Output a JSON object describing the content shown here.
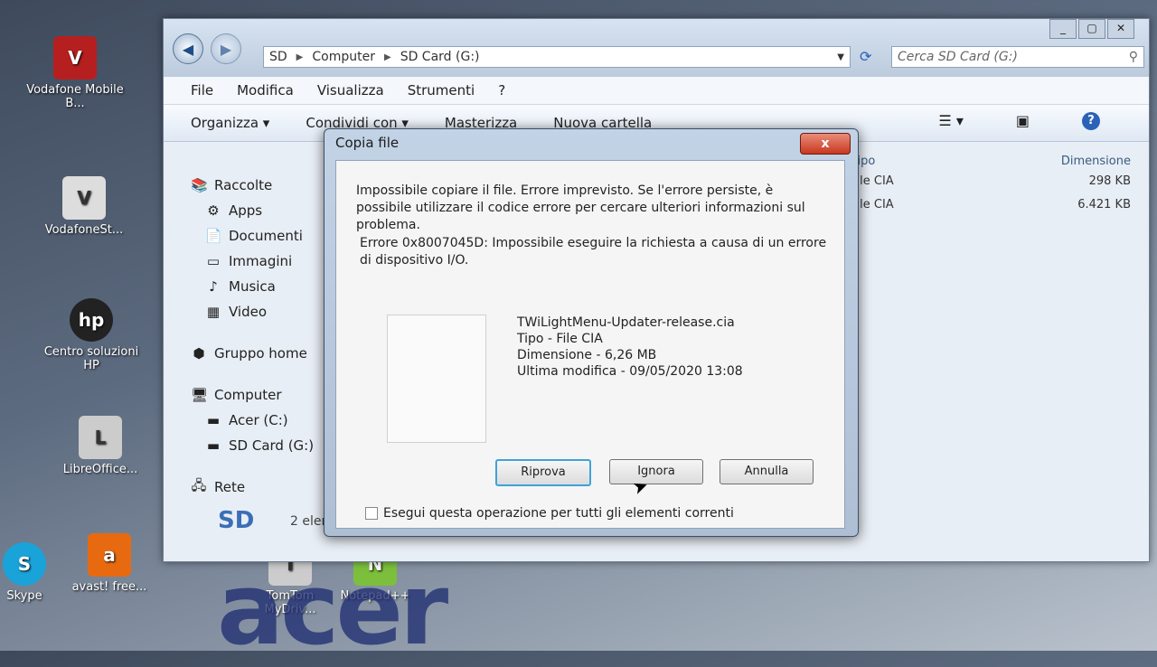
{
  "desktop": {
    "icons": [
      {
        "label": "Vodafone Mobile B...",
        "name": "vodafone-mobile-broadband",
        "glyph": "V",
        "color": "#b61f1f"
      },
      {
        "label": "VodafoneSt...",
        "name": "vodafone-st",
        "glyph": "V",
        "color": "#dddddd"
      },
      {
        "label": "Centro soluzioni HP",
        "name": "centro-soluzioni-hp",
        "glyph": "hp",
        "color": "#222222"
      },
      {
        "label": "LibreOffice...",
        "name": "libreoffice",
        "glyph": "L",
        "color": "#cccccc"
      },
      {
        "label": "avast! free...",
        "name": "avast",
        "glyph": "a",
        "color": "#e86a10"
      },
      {
        "label": "Skype",
        "name": "skype",
        "glyph": "S",
        "color": "#1aa3d8"
      },
      {
        "label": "TomTom MyDriv...",
        "name": "tomtom",
        "glyph": "T",
        "color": "#cccccc"
      },
      {
        "label": "Notepad++",
        "name": "notepad-plus-plus",
        "glyph": "N",
        "color": "#7cbf3c"
      }
    ],
    "brand_text": "acer"
  },
  "explorer": {
    "breadcrumb": [
      "SD",
      "Computer",
      "SD Card (G:)"
    ],
    "search_placeholder": "Cerca SD Card (G:)",
    "menu": [
      "File",
      "Modifica",
      "Visualizza",
      "Strumenti",
      "?"
    ],
    "toolbar": {
      "organize": "Organizza ▾",
      "share": "Condividi con ▾",
      "burn": "Masterizza",
      "new_folder": "Nuova cartella"
    },
    "nav_pane": {
      "raccolte": "Raccolte",
      "apps": "Apps",
      "documenti": "Documenti",
      "immagini": "Immagini",
      "musica": "Musica",
      "video": "Video",
      "gruppo_home": "Gruppo home",
      "computer": "Computer",
      "acer_c": "Acer (C:)",
      "sd_card_g": "SD Card (G:)",
      "rete": "Rete"
    },
    "file_list": {
      "col_type": "Tipo",
      "col_size": "Dimensione",
      "rows": [
        {
          "type": "File CIA",
          "size": "298 KB"
        },
        {
          "type": "File CIA",
          "size": "6.421 KB"
        }
      ]
    },
    "status": {
      "drive_label": "SD",
      "count": "2 elementi"
    }
  },
  "dialog": {
    "title": "Copia file",
    "close_label": "x",
    "message": "Impossibile copiare il file. Errore imprevisto. Se l'errore persiste, è possibile utilizzare il codice errore per cercare ulteriori informazioni sul problema.",
    "error": "Errore 0x8007045D: Impossibile eseguire la richiesta a causa di un errore di dispositivo I/O.",
    "file": {
      "name": "TWiLightMenu-Updater-release.cia",
      "type": "Tipo - File CIA",
      "size": "Dimensione - 6,26 MB",
      "modified": "Ultima modifica - 09/05/2020 13:08"
    },
    "buttons": {
      "retry": "Riprova",
      "ignore": "Ignora",
      "cancel": "Annulla"
    },
    "checkbox_label": "Esegui questa operazione per tutti gli elementi correnti"
  }
}
